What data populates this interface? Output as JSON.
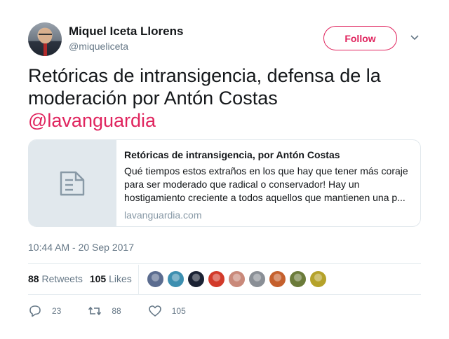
{
  "user": {
    "name": "Miquel Iceta Llorens",
    "handle": "@miqueliceta"
  },
  "follow_label": "Follow",
  "tweet": {
    "text": "Retóricas de intransigencia, defensa de la moderación por Antón Costas",
    "mention": "@lavanguardia"
  },
  "card": {
    "title": "Retóricas de intransigencia, por Antón Costas",
    "description": "Qué tiempos estos extraños en los que hay que tener más coraje para ser moderado que radical o conservador! Hay un hostigamiento creciente a todos aquellos que mantienen una p...",
    "domain": "lavanguardia.com",
    "thumb_icon": "document-icon"
  },
  "timestamp": "10:44 AM - 20 Sep 2017",
  "stats": {
    "retweets_count": "88",
    "retweets_label": "Retweets",
    "likes_count": "105",
    "likes_label": "Likes"
  },
  "likers": [
    {
      "name": "liker-avatar-1",
      "color": "#5b6c8f"
    },
    {
      "name": "liker-avatar-2",
      "color": "#3d8fb0"
    },
    {
      "name": "liker-avatar-3",
      "color": "#1b2233"
    },
    {
      "name": "liker-avatar-4",
      "color": "#d23a2a"
    },
    {
      "name": "liker-avatar-5",
      "color": "#c9897a"
    },
    {
      "name": "liker-avatar-6",
      "color": "#8a8f96"
    },
    {
      "name": "liker-avatar-7",
      "color": "#c5602d"
    },
    {
      "name": "liker-avatar-8",
      "color": "#6b7b3a"
    },
    {
      "name": "liker-avatar-9",
      "color": "#b5a22a"
    }
  ],
  "actions": {
    "reply_count": "23",
    "retweet_count": "88",
    "like_count": "105"
  },
  "colors": {
    "accent": "#e0245e",
    "secondary_text": "#657786",
    "border": "#e1e8ed"
  }
}
